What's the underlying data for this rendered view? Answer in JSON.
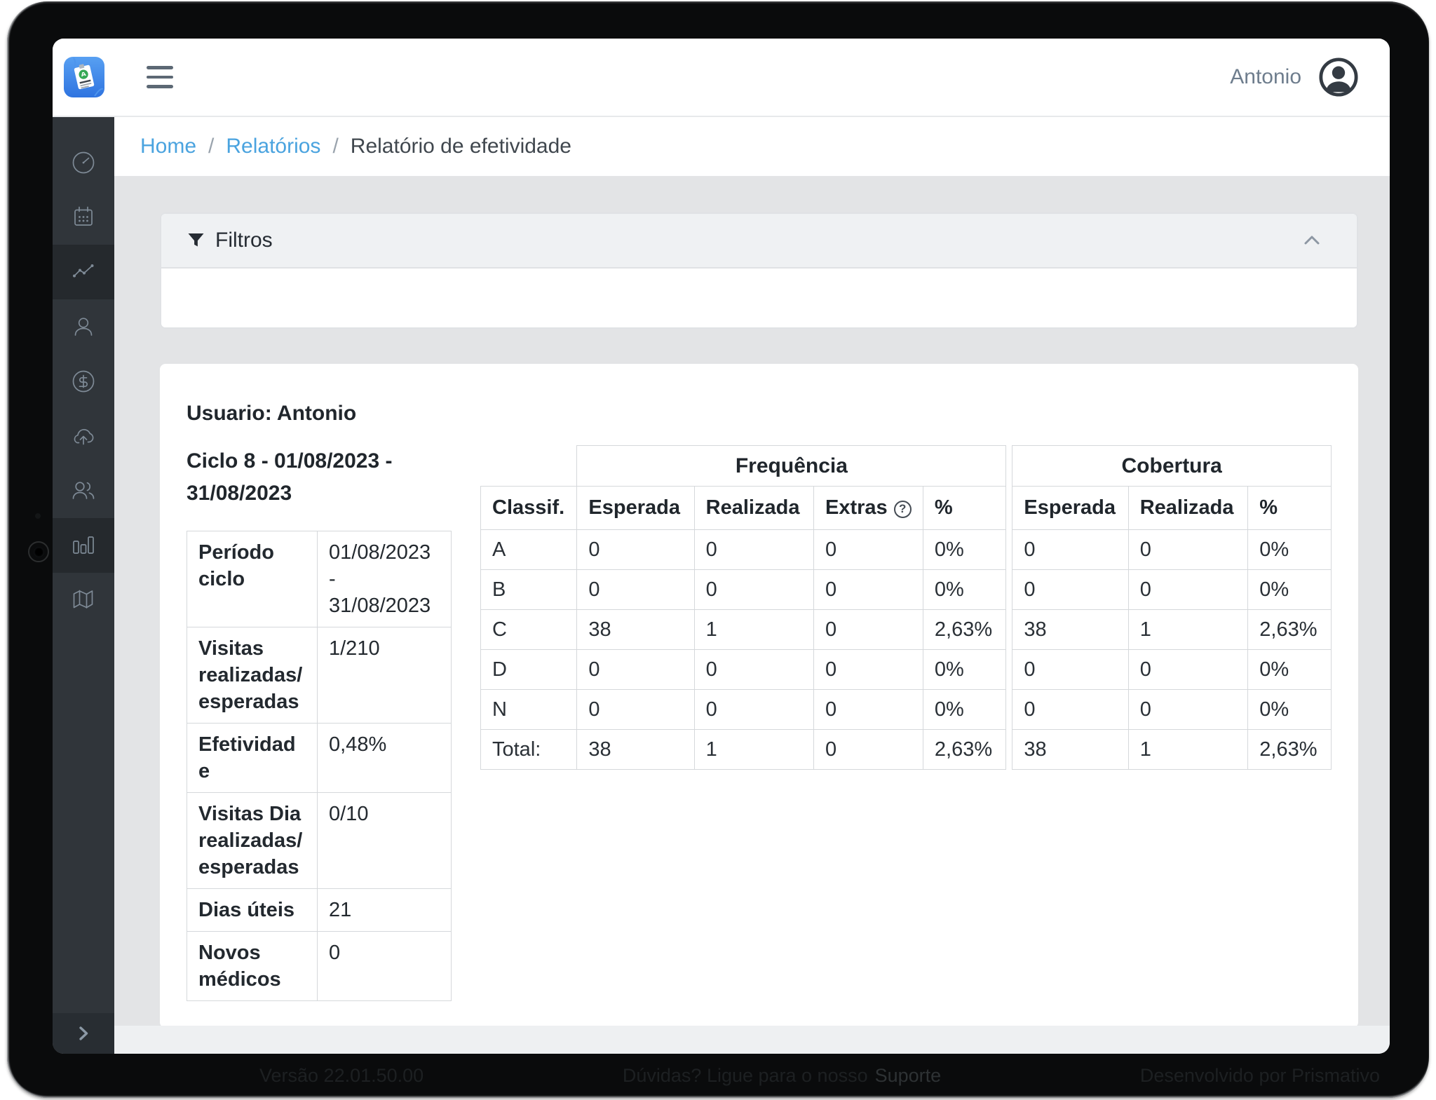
{
  "header": {
    "username": "Antonio",
    "logo_icon": "app-badge-logo",
    "menu_icon": "hamburger-icon",
    "avatar_icon": "user-avatar-icon"
  },
  "breadcrumb": {
    "separator": "/",
    "items": [
      {
        "label": "Home",
        "link": true
      },
      {
        "label": "Relatórios",
        "link": true
      },
      {
        "label": "Relatório de efetividade",
        "link": false
      }
    ]
  },
  "sidebar": {
    "icons": [
      "gauge-icon",
      "calendar-icon",
      "trend-chart-icon",
      "user-icon",
      "dollar-icon",
      "cloud-upload-icon",
      "users-icon",
      "bar-chart-icon",
      "map-icon"
    ],
    "active_indices": [
      2,
      7
    ],
    "collapse_icon": "chevron-right-icon"
  },
  "filters": {
    "label": "Filtros",
    "funnel_icon": "funnel-icon",
    "collapse_icon": "chevron-up-icon"
  },
  "report": {
    "usuario_heading": "Usuario: Antonio",
    "ciclo_heading": "Ciclo 8 - 01/08/2023 - 31/08/2023",
    "info_table": {
      "rows": [
        {
          "label": "Período ciclo",
          "value": "01/08/2023 - 31/08/2023"
        },
        {
          "label": "Visitas realizadas/esperadas",
          "value": "1/210"
        },
        {
          "label": "Efetividade",
          "value": "0,48%"
        },
        {
          "label": "Visitas Dia realizadas/esperadas",
          "value": "0/10"
        },
        {
          "label": "Dias úteis",
          "value": "21"
        },
        {
          "label": "Novos médicos",
          "value": "0"
        }
      ]
    },
    "classif_label": "Classif.",
    "frequencia": {
      "title": "Frequência",
      "headers": [
        "Esperada",
        "Realizada",
        "Extras",
        "%"
      ],
      "extras_help": "?"
    },
    "cobertura": {
      "title": "Cobertura",
      "headers": [
        "Esperada",
        "Realizada",
        "%"
      ]
    },
    "rows": [
      {
        "label": "A",
        "freq": [
          "0",
          "0",
          "0",
          "0%"
        ],
        "cob": [
          "0",
          "0",
          "0%"
        ]
      },
      {
        "label": "B",
        "freq": [
          "0",
          "0",
          "0",
          "0%"
        ],
        "cob": [
          "0",
          "0",
          "0%"
        ]
      },
      {
        "label": "C",
        "freq": [
          "38",
          "1",
          "0",
          "2,63%"
        ],
        "cob": [
          "38",
          "1",
          "2,63%"
        ]
      },
      {
        "label": "D",
        "freq": [
          "0",
          "0",
          "0",
          "0%"
        ],
        "cob": [
          "0",
          "0",
          "0%"
        ]
      },
      {
        "label": "N",
        "freq": [
          "0",
          "0",
          "0",
          "0%"
        ],
        "cob": [
          "0",
          "0",
          "0%"
        ]
      },
      {
        "label": "Total:",
        "freq": [
          "38",
          "1",
          "0",
          "2,63%"
        ],
        "cob": [
          "38",
          "1",
          "2,63%"
        ]
      }
    ]
  },
  "device_footer": {
    "version": "Versão 22.01.50.00",
    "support": "Dúvidas? Ligue para o nosso",
    "support_link": "Suporte",
    "developer": "Desenvolvido por Prismativo"
  },
  "colors": {
    "accent_blue": "#4aa3df",
    "sidebar_bg": "#30353a",
    "sidebar_active": "#25292d",
    "logo_blue": "#3b82e8",
    "logo_green": "#35a854",
    "content_bg": "#e3e4e6"
  }
}
